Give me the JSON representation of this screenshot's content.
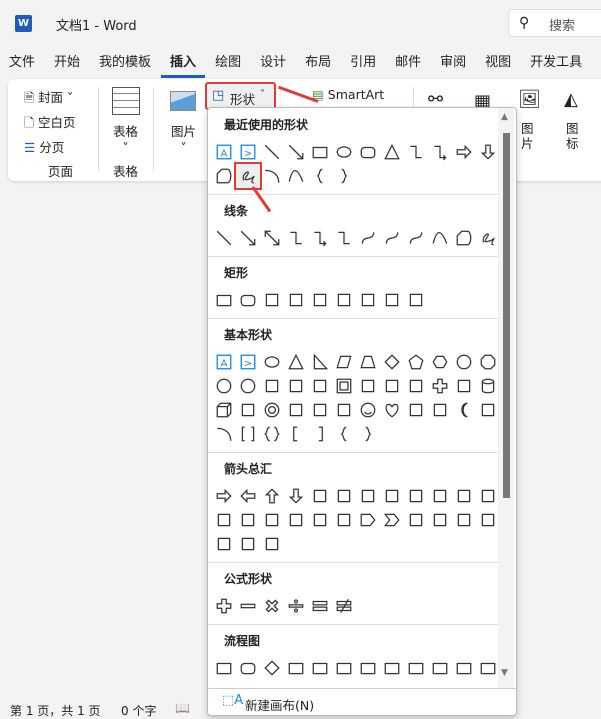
{
  "titlebar": {
    "logo": "W",
    "title": "文档1  -  Word",
    "search_placeholder": "搜索"
  },
  "tabs": [
    "文件",
    "开始",
    "我的模板",
    "插入",
    "绘图",
    "设计",
    "布局",
    "引用",
    "邮件",
    "审阅",
    "视图",
    "开发工具"
  ],
  "active_tab": "插入",
  "ribbon": {
    "cover": "封面",
    "blank_page": "空白页",
    "page_break": "分页",
    "group_pages": "页面",
    "table": "表格",
    "group_table": "表格",
    "picture": "图片",
    "shapes": "形状",
    "smartart": "SmartArt",
    "picture2": "图片",
    "icons": "图标"
  },
  "dropdown": {
    "sections": [
      {
        "title": "最近使用的形状",
        "shapes": [
          "textbox",
          "vtextbox",
          "line",
          "arrow-line",
          "rect",
          "ellipse",
          "roundrect",
          "triangle",
          "elbow",
          "elbow-arrow",
          "right-arrow",
          "down-arrow",
          "freeform",
          "scribble",
          "arc",
          "curve",
          "lbrace",
          "rbrace"
        ]
      },
      {
        "title": "线条",
        "shapes": [
          "line",
          "arrow-line",
          "double-arrow-line",
          "elbow",
          "elbow-arrow",
          "elbow-double",
          "curved",
          "curved-arrow",
          "curved-double",
          "curve",
          "freeform",
          "scribble"
        ]
      },
      {
        "title": "矩形",
        "shapes": [
          "rect",
          "roundrect",
          "snip1",
          "snip2",
          "snip3",
          "snip-round",
          "round1",
          "round2",
          "round-diag"
        ]
      },
      {
        "title": "基本形状",
        "shapes": [
          "textbox",
          "vtextbox",
          "ellipse",
          "triangle",
          "rtriangle",
          "parallelogram",
          "trapezoid",
          "diamond",
          "pentagon",
          "hexagon",
          "heptagon",
          "octagon",
          "decagon",
          "dodecagon",
          "pie",
          "chord",
          "teardrop",
          "frame",
          "halfframe",
          "lshape",
          "diagstripe",
          "plus",
          "plaque",
          "can",
          "cube",
          "bevel",
          "donut",
          "nosymbol",
          "blockarc",
          "foldedcorner",
          "smiley",
          "heart",
          "lightning",
          "sun",
          "moon",
          "cloud",
          "arc",
          "brackets",
          "braces",
          "lbracket",
          "rbracket",
          "lbrace",
          "rbrace"
        ]
      },
      {
        "title": "箭头总汇",
        "shapes": [
          "right-arrow",
          "left-arrow",
          "up-arrow",
          "down-arrow",
          "lr-arrow",
          "ud-arrow",
          "quad-arrow",
          "lru-arrow",
          "bent-arrow",
          "uturn",
          "lup-arrow",
          "bentup",
          "curved-r",
          "curved-l",
          "curved-u",
          "curved-d",
          "striped",
          "notched",
          "pentagon-arrow",
          "chevron",
          "right-callout",
          "down-callout",
          "left-callout",
          "up-callout",
          "lr-callout",
          "quad-callout",
          "circular"
        ]
      },
      {
        "title": "公式形状",
        "shapes": [
          "plus",
          "minus",
          "multiply",
          "divide",
          "equal",
          "notequal"
        ]
      },
      {
        "title": "流程图",
        "shapes": [
          "rect",
          "roundrect",
          "diamond",
          "rect",
          "rect",
          "rect",
          "rect",
          "rect",
          "rect",
          "rect",
          "rect",
          "rect"
        ]
      }
    ],
    "selected": "scribble",
    "new_canvas": "新建画布(N)"
  },
  "status": {
    "page": "第 1 页，共 1 页",
    "words": "0 个字"
  },
  "colors": {
    "accent": "#1e5db8",
    "highlight": "#e53935",
    "textbox_blue": "#1e88e5"
  }
}
